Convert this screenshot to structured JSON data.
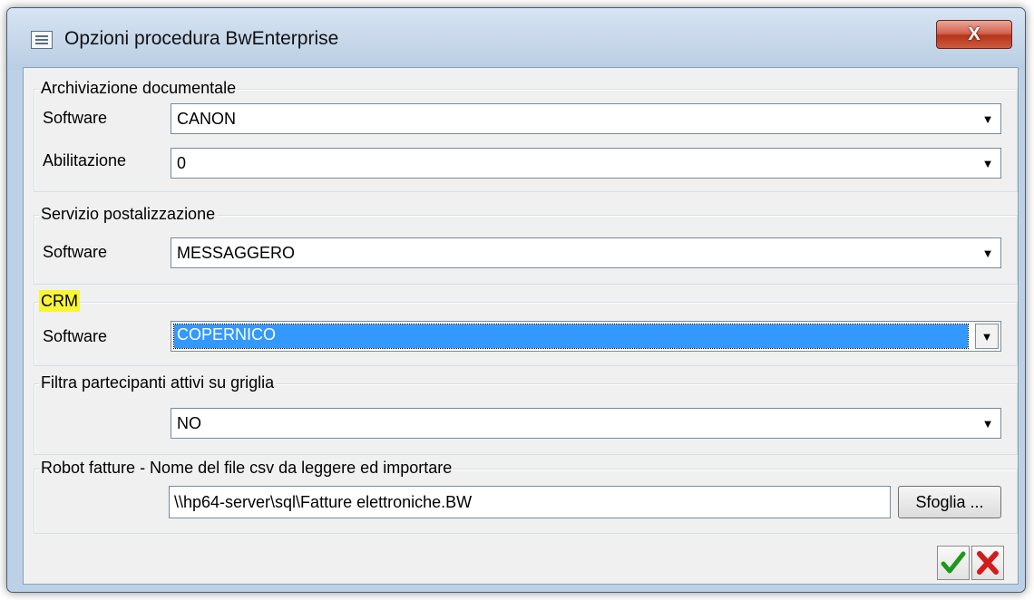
{
  "window": {
    "title": "Opzioni procedura BwEnterprise",
    "close_label": "X"
  },
  "sections": {
    "archiviazione": {
      "legend": "Archiviazione documentale",
      "software_label": "Software",
      "software_value": "CANON",
      "abilitazione_label": "Abilitazione",
      "abilitazione_value": "0"
    },
    "postalizzazione": {
      "legend": "Servizio postalizzazione",
      "software_label": "Software",
      "software_value": "MESSAGGERO"
    },
    "crm": {
      "legend": "CRM",
      "software_label": "Software",
      "software_value": "COPERNICO"
    },
    "filtra": {
      "legend": "Filtra partecipanti attivi su griglia",
      "value": "NO"
    },
    "robot": {
      "legend": "Robot fatture - Nome del file csv da leggere ed importare",
      "path_value": "\\\\hp64-server\\sql\\Fatture elettroniche.BW",
      "browse_label": "Sfoglia ..."
    }
  },
  "actions": {
    "ok_icon": "check-icon",
    "cancel_icon": "x-icon"
  },
  "colors": {
    "selection": "#3399ff",
    "highlight": "#f8f536",
    "ok": "#1a9a1a",
    "cancel": "#d21c1c"
  }
}
